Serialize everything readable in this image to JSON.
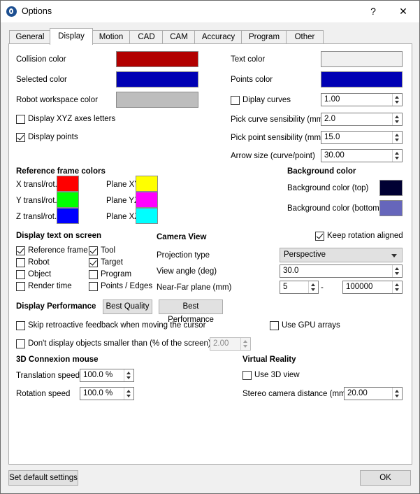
{
  "window": {
    "title": "Options",
    "help": "?",
    "close": "✕"
  },
  "tabs": [
    "General",
    "Display",
    "Motion",
    "CAD",
    "CAM",
    "Accuracy",
    "Program",
    "Other"
  ],
  "colors": {
    "collision": "#b20000",
    "selected": "#0000b4",
    "robot_workspace": "#bdbdbd",
    "text": "#f0f0f0",
    "points": "#0000b4",
    "x": "#ff0000",
    "y": "#00ff00",
    "z": "#0000ff",
    "xy": "#ffff00",
    "yz": "#ff00ff",
    "xz": "#00ffff",
    "bg_top": "#000033",
    "bg_bottom": "#6666bb"
  },
  "color_labels": {
    "collision": "Collision color",
    "selected": "Selected color",
    "robot_workspace": "Robot workspace color",
    "text": "Text color",
    "points": "Points color"
  },
  "checks": {
    "xyz_letters": "Display XYZ axes letters",
    "display_points": "Display points",
    "display_curves": "Diplay curves"
  },
  "right_fields": {
    "curves_value": "1.00",
    "pick_curve_label": "Pick curve sensibility (mm)",
    "pick_curve_value": "2.0",
    "pick_point_label": "Pick point sensibility (mm)",
    "pick_point_value": "15.0",
    "arrow_label": "Arrow size (curve/point)",
    "arrow_value": "30.00"
  },
  "ref_frame": {
    "title": "Reference frame colors",
    "x": "X transl/rot.",
    "y": "Y transl/rot.",
    "z": "Z transl/rot.",
    "xy": "Plane XY",
    "yz": "Plane YZ",
    "xz": "Plane XZ"
  },
  "background": {
    "title": "Background color",
    "top": "Background color (top)",
    "bottom": "Background color (bottom)"
  },
  "display_text": {
    "title": "Display text on screen",
    "reference_frame": "Reference frame",
    "tool": "Tool",
    "robot": "Robot",
    "target": "Target",
    "object": "Object",
    "program": "Program",
    "render_time": "Render time",
    "points_edges": "Points / Edges"
  },
  "camera": {
    "title": "Camera View",
    "keep_rotation": "Keep rotation aligned",
    "projection_label": "Projection type",
    "projection_value": "Perspective",
    "view_angle_label": "View angle (deg)",
    "view_angle_value": "30.0",
    "near_far_label": "Near-Far plane (mm)",
    "near_value": "5",
    "far_value": "100000",
    "dash": "-"
  },
  "performance": {
    "title": "Display Performance",
    "best_quality": "Best Quality",
    "best_performance": "Best Performance",
    "skip_retro": "Skip retroactive feedback when moving the cursor",
    "use_gpu": "Use GPU arrays",
    "dont_display": "Don't display objects smaller than (% of the screen)",
    "dont_display_value": "2.00"
  },
  "connexion": {
    "title": "3D Connexion mouse",
    "translation_label": "Translation speed",
    "translation_value": "100.0 %",
    "rotation_label": "Rotation speed",
    "rotation_value": "100.0 %"
  },
  "vr": {
    "title": "Virtual Reality",
    "use_3d": "Use 3D view",
    "stereo_label": "Stereo camera distance (mm)",
    "stereo_value": "20.00"
  },
  "footer": {
    "defaults": "Set default settings",
    "ok": "OK"
  }
}
